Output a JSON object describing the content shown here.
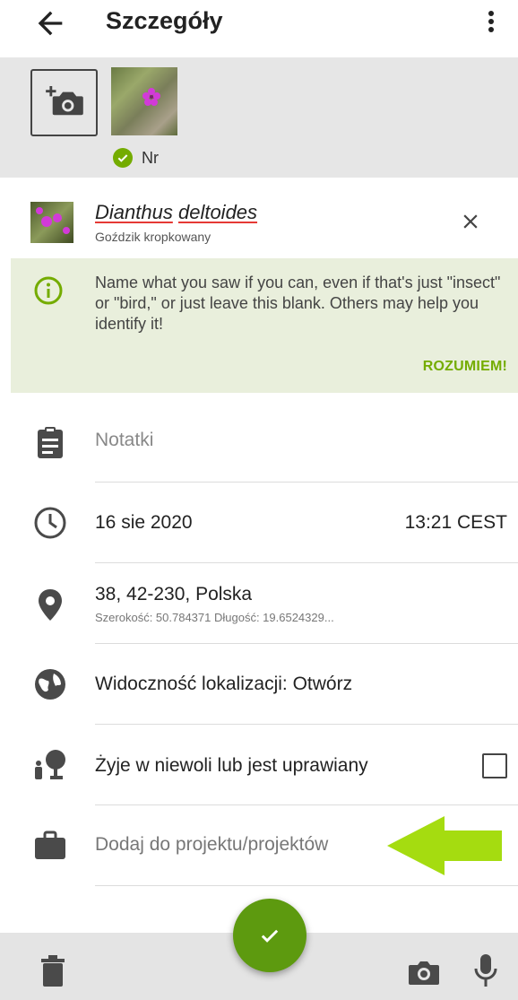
{
  "header": {
    "title": "Szczegóły"
  },
  "photos": {
    "status_label": "Nr"
  },
  "species": {
    "genus": "Dianthus",
    "epithet": "deltoides",
    "common_name": "Goździk kropkowany"
  },
  "tip": {
    "text": "Name what you saw if you can, even if that's just \"insect\" or \"bird,\" or just leave this blank. Others may help you identify it!",
    "dismiss_label": "ROZUMIEM!"
  },
  "fields": {
    "notes_placeholder": "Notatki",
    "date": "16 sie 2020",
    "time": "13:21 CEST",
    "location_name": "38, 42-230, Polska",
    "location_coords": "Szerokość: 50.784371 Długość: 19.6524329...",
    "visibility": "Widoczność lokalizacji: Otwórz",
    "captive_label": "Żyje w niewoli lub jest uprawiany",
    "captive_checked": false,
    "projects_placeholder": "Dodaj do projektu/projektów"
  },
  "colors": {
    "accent": "#74ac00",
    "fab": "#5d9a0f",
    "tip_bg": "#e9efdc",
    "photo_bar_bg": "#e6e6e6",
    "annotation_arrow": "#a5dc10"
  },
  "icons": {
    "back": "arrow-left-icon",
    "menu": "more-vert-icon",
    "add_photo": "add-photo-icon",
    "close": "close-icon",
    "info": "info-icon",
    "notes": "clipboard-icon",
    "date": "clock-icon",
    "location": "location-pin-icon",
    "visibility": "globe-icon",
    "captive": "tree-person-icon",
    "projects": "briefcase-icon",
    "delete": "trash-icon",
    "camera": "camera-icon",
    "mic": "microphone-icon",
    "save": "check-icon"
  }
}
